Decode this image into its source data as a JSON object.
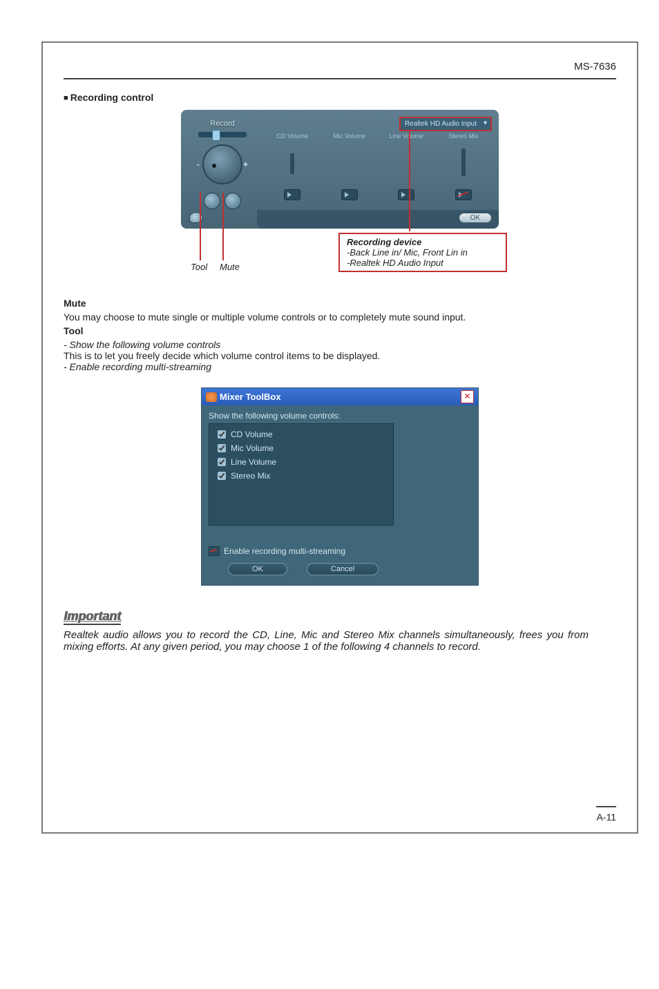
{
  "doc": {
    "model": "MS-7636",
    "page_number": "A-11"
  },
  "section_recording": "Recording control",
  "record_panel": {
    "record_label": "Record",
    "device_selected": "Realtek HD Audio Input",
    "columns": [
      "CD Volume",
      "Mic Volume",
      "Line Volume",
      "Stereo Mix"
    ],
    "ok": "OK"
  },
  "callouts": {
    "tool": "Tool",
    "mute": "Mute",
    "device_header": "Recording device",
    "device_line1": "-Back Line in/ Mic, Front Lin in",
    "device_line2": "-Realtek HD Audio Input"
  },
  "mute": {
    "heading": "Mute",
    "text": "You may choose to mute single or multiple volume controls or to completely mute sound input."
  },
  "tool": {
    "heading": "Tool",
    "sub1": "- Show the following volume controls",
    "sub1_text": "This is to let you freely decide which volume control items to be displayed.",
    "sub2": "- Enable recording multi-streaming"
  },
  "toolbox": {
    "title": "Mixer ToolBox",
    "show_label": "Show the following volume controls:",
    "items": [
      "CD Volume",
      "Mic Volume",
      "Line Volume",
      "Stereo Mix"
    ],
    "multi": "Enable recording multi-streaming",
    "ok": "OK",
    "cancel": "Cancel"
  },
  "important": {
    "heading": "Important",
    "text": "Realtek audio allows you to record the CD, Line, Mic and Stereo Mix channels simultaneously, frees you from mixing efforts. At any given period, you may choose 1 of the following 4 channels to record."
  }
}
